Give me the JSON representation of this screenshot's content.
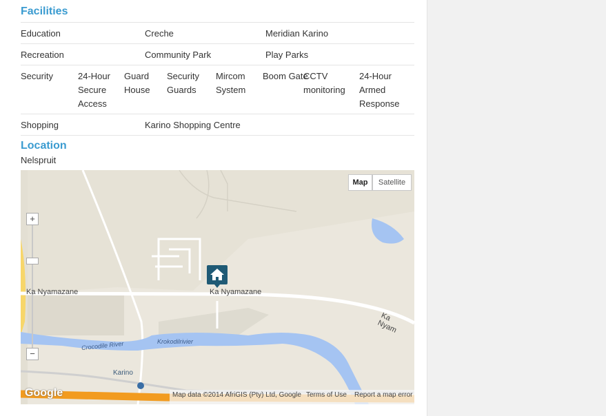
{
  "facilities": {
    "heading": "Facilities",
    "education": {
      "label": "Education",
      "v1": "Creche",
      "v2": "Meridian Karino"
    },
    "recreation": {
      "label": "Recreation",
      "v1": "Community Park",
      "v2": "Play Parks"
    },
    "security": {
      "label": "Security",
      "items": [
        "24-Hour Secure Access",
        "Guard House",
        "Security Guards",
        "Mircom System",
        "Boom Gate",
        "CCTV monitoring",
        "24-Hour Armed Response"
      ]
    },
    "shopping": {
      "label": "Shopping",
      "v1": "Karino Shopping Centre"
    }
  },
  "location": {
    "heading": "Location",
    "town": "Nelspruit"
  },
  "map": {
    "type_map": "Map",
    "type_satellite": "Satellite",
    "zoom_in": "+",
    "zoom_out": "−",
    "labels": {
      "road_left": "Ka Nyamazane",
      "road_mid": "Ka Nyamazane",
      "road_right": "Ka Nyam",
      "river1": "Crocodile River",
      "river2": "Krokodilrivier",
      "station": "Karino"
    },
    "google": "Google",
    "attribution": "Map data ©2014 AfriGIS (Pty) Ltd, Google",
    "terms": "Terms of Use",
    "report": "Report a map error",
    "marker": "house-marker"
  }
}
